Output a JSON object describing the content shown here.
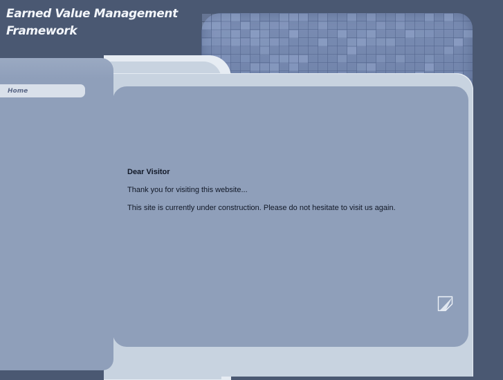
{
  "header": {
    "title_line1": "Earned Value Management",
    "title_line2": "Framework"
  },
  "nav": {
    "items": [
      {
        "label": "Home"
      }
    ]
  },
  "main": {
    "greeting": "Dear Visitor",
    "thanks": "Thank you for visiting this website...",
    "notice": "This site is currently under construction. Please do not hesitate to visit us again."
  },
  "icons": {
    "corner": "page-curl-icon"
  },
  "colors": {
    "background": "#4a5872",
    "panel": "#8f9fba",
    "pale_panel": "#c8d3e0",
    "nav_highlight": "#d9e0ea",
    "mosaic": "#6b7ea5"
  }
}
